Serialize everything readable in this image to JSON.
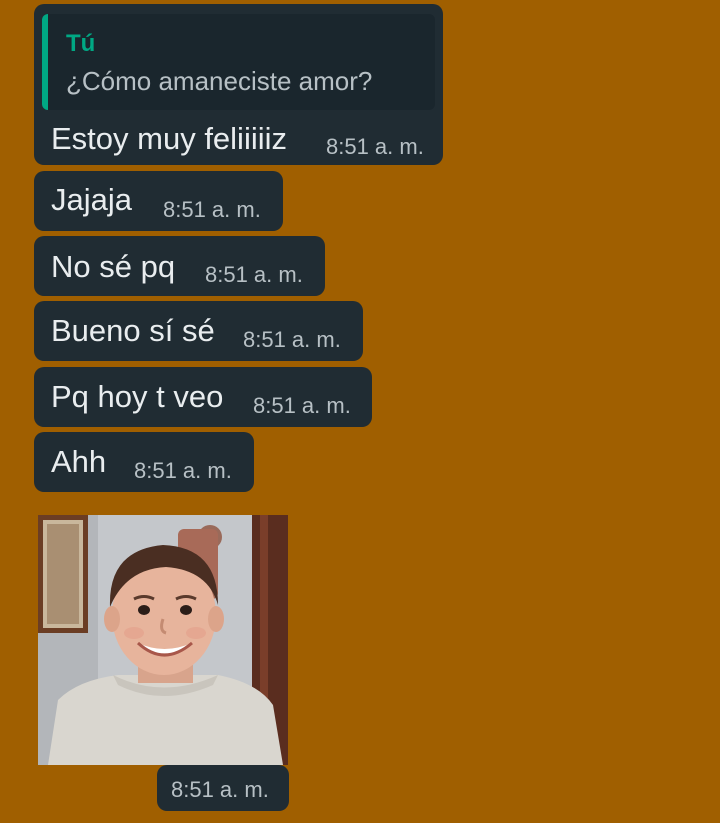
{
  "colors": {
    "background": "#a05f00",
    "bubble": "#202c33",
    "quote_accent": "#00a884"
  },
  "reply": {
    "quote_author": "Tú",
    "quote_text": "¿Cómo amaneciste amor?",
    "text": "Estoy muy feliiiiiz",
    "time": "8:51 a. m."
  },
  "messages": [
    {
      "text": "Jajaja",
      "time": "8:51 a. m."
    },
    {
      "text": "No sé pq",
      "time": "8:51 a. m."
    },
    {
      "text": "Bueno sí sé",
      "time": "8:51 a. m."
    },
    {
      "text": "Pq hoy t veo",
      "time": "8:51 a. m."
    },
    {
      "text": "Ahh",
      "time": "8:51 a. m."
    }
  ],
  "image_message": {
    "description_icon": "photo-of-smiling-boy",
    "time": "8:51 a. m."
  }
}
